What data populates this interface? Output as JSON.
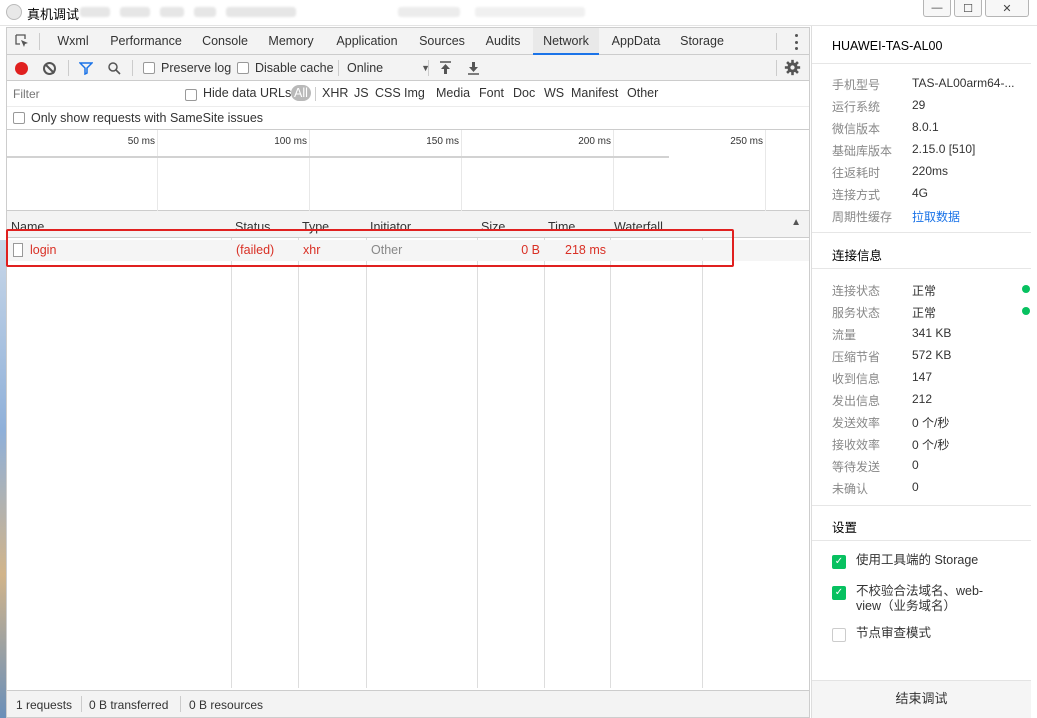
{
  "window": {
    "title": "真机调试",
    "controls": {
      "minimize": "—",
      "maximize": "☐",
      "close": "✕"
    }
  },
  "tabs": [
    "Wxml",
    "Performance",
    "Console",
    "Memory",
    "Application",
    "Sources",
    "Audits",
    "Network",
    "AppData",
    "Storage"
  ],
  "active_tab": "Network",
  "toolbar": {
    "preserve_log": "Preserve log",
    "disable_cache": "Disable cache",
    "throttle": "Online"
  },
  "filter": {
    "placeholder": "Filter",
    "hide_data_urls": "Hide data URLs",
    "types": [
      "All",
      "XHR",
      "JS",
      "CSS",
      "Img",
      "Media",
      "Font",
      "Doc",
      "WS",
      "Manifest",
      "Other"
    ],
    "samesite": "Only show requests with SameSite issues"
  },
  "overview": {
    "ticks": [
      "50 ms",
      "100 ms",
      "150 ms",
      "200 ms",
      "250 ms"
    ]
  },
  "columns": [
    "Name",
    "Status",
    "Type",
    "Initiator",
    "Size",
    "Time",
    "Waterfall"
  ],
  "requests": [
    {
      "name": "login",
      "status": "(failed)",
      "type": "xhr",
      "initiator": "Other",
      "size": "0 B",
      "time": "218 ms"
    }
  ],
  "status_bar": {
    "requests": "1 requests",
    "transferred": "0 B transferred",
    "resources": "0 B resources"
  },
  "device": {
    "name": "HUAWEI-TAS-AL00",
    "info": [
      {
        "k": "手机型号",
        "v": "TAS-AL00arm64-..."
      },
      {
        "k": "运行系统",
        "v": "29"
      },
      {
        "k": "微信版本",
        "v": "8.0.1"
      },
      {
        "k": "基础库版本",
        "v": "2.15.0 [510]"
      },
      {
        "k": "往返耗时",
        "v": "220ms"
      },
      {
        "k": "连接方式",
        "v": "4G"
      },
      {
        "k": "周期性缓存",
        "v": "拉取数据"
      }
    ]
  },
  "connection": {
    "title": "连接信息",
    "items": [
      {
        "k": "连接状态",
        "v": "正常"
      },
      {
        "k": "服务状态",
        "v": "正常"
      },
      {
        "k": "流量",
        "v": "341 KB"
      },
      {
        "k": "压缩节省",
        "v": "572 KB"
      },
      {
        "k": "收到信息",
        "v": "147"
      },
      {
        "k": "发出信息",
        "v": "212"
      },
      {
        "k": "发送效率",
        "v": "0 个/秒"
      },
      {
        "k": "接收效率",
        "v": "0 个/秒"
      },
      {
        "k": "等待发送",
        "v": "0"
      },
      {
        "k": "未确认",
        "v": "0"
      }
    ]
  },
  "settings": {
    "title": "设置",
    "items": [
      {
        "label": "使用工具端的 Storage",
        "checked": true
      },
      {
        "label": "不校验合法域名、web-view（业务域名）",
        "checked": true
      },
      {
        "label": "节点审查模式",
        "checked": false
      }
    ]
  },
  "end_button": "结束调试",
  "colors": {
    "record": "#e0201f",
    "error": "#d93025",
    "ok": "#07c160",
    "link": "#1a73e8"
  }
}
